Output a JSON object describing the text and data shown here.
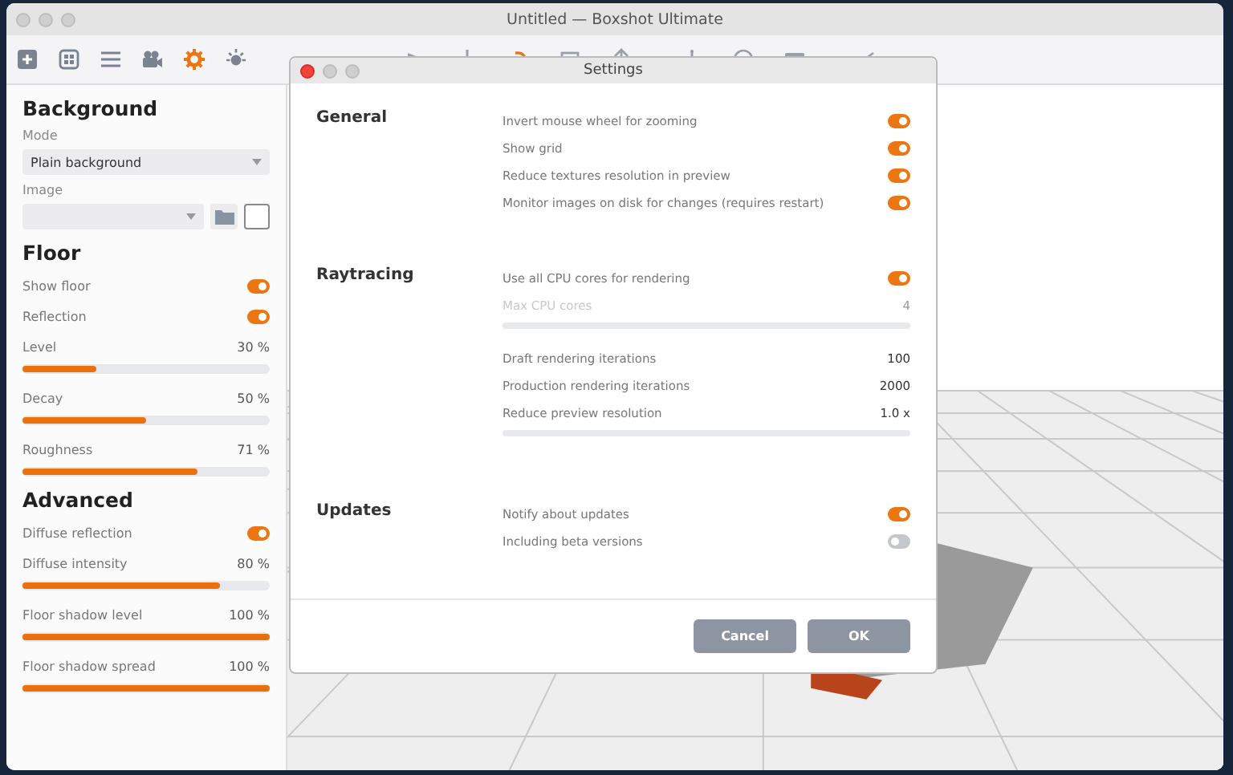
{
  "window": {
    "title": "Untitled — Boxshot Ultimate"
  },
  "toolbar": {
    "tabs": [
      {
        "selected": false
      },
      {
        "selected": false
      },
      {
        "selected": false
      },
      {
        "selected": false
      },
      {
        "selected": true
      },
      {
        "selected": false
      }
    ]
  },
  "panel": {
    "sections": [
      {
        "title": "Background",
        "items": [
          {
            "kind": "caption",
            "label": "Mode"
          },
          {
            "kind": "dropdown",
            "value": "Plain background"
          },
          {
            "kind": "caption",
            "label": "Image"
          },
          {
            "kind": "image_picker"
          }
        ]
      },
      {
        "title": "Floor",
        "items": [
          {
            "kind": "toggle",
            "label": "Show floor",
            "on": true
          },
          {
            "kind": "toggle",
            "label": "Reflection",
            "on": true
          },
          {
            "kind": "slider",
            "label": "Level",
            "reading": "30 %",
            "level": 0.3
          },
          {
            "kind": "slider",
            "label": "Decay",
            "reading": "50 %",
            "level": 0.5
          },
          {
            "kind": "slider",
            "label": "Roughness",
            "reading": "71 %",
            "level": 0.71
          }
        ]
      },
      {
        "title": "Advanced",
        "items": [
          {
            "kind": "toggle",
            "label": "Diffuse reflection",
            "on": true
          },
          {
            "kind": "slider",
            "label": "Diffuse intensity",
            "reading": "80 %",
            "level": 0.8
          },
          {
            "kind": "slider",
            "label": "Floor shadow level",
            "reading": "100 %",
            "level": 1
          },
          {
            "kind": "slider",
            "label": "Floor shadow spread",
            "reading": "100 %",
            "level": 1
          }
        ]
      }
    ]
  },
  "settings_dialog": {
    "title": "Settings",
    "sections": [
      {
        "title": "General",
        "rows": [
          {
            "kind": "toggle",
            "label": "Invert mouse wheel for zooming",
            "on": true
          },
          {
            "kind": "toggle",
            "label": "Show grid",
            "on": true
          },
          {
            "kind": "toggle",
            "label": "Reduce textures resolution in preview",
            "on": true
          },
          {
            "kind": "toggle",
            "label": "Monitor images on disk for changes (requires restart)",
            "on": true
          }
        ]
      },
      {
        "title": "Raytracing",
        "rows": [
          {
            "kind": "toggle",
            "label": "Use all CPU cores for rendering",
            "on": true
          },
          {
            "kind": "slider",
            "label": "Max CPU cores",
            "reading": "4",
            "disabled": true
          },
          {
            "kind": "value",
            "label": "Draft rendering iterations",
            "value": "100"
          },
          {
            "kind": "value",
            "label": "Production rendering iterations",
            "value": "2000"
          },
          {
            "kind": "slider",
            "label": "Reduce preview resolution",
            "reading": "1.0 x",
            "disabled": false
          }
        ]
      },
      {
        "title": "Updates",
        "rows": [
          {
            "kind": "toggle",
            "label": "Notify about updates",
            "on": true
          },
          {
            "kind": "toggle",
            "label": "Including beta versions",
            "on": false
          }
        ]
      }
    ],
    "buttons": [
      "Cancel",
      "OK"
    ]
  }
}
